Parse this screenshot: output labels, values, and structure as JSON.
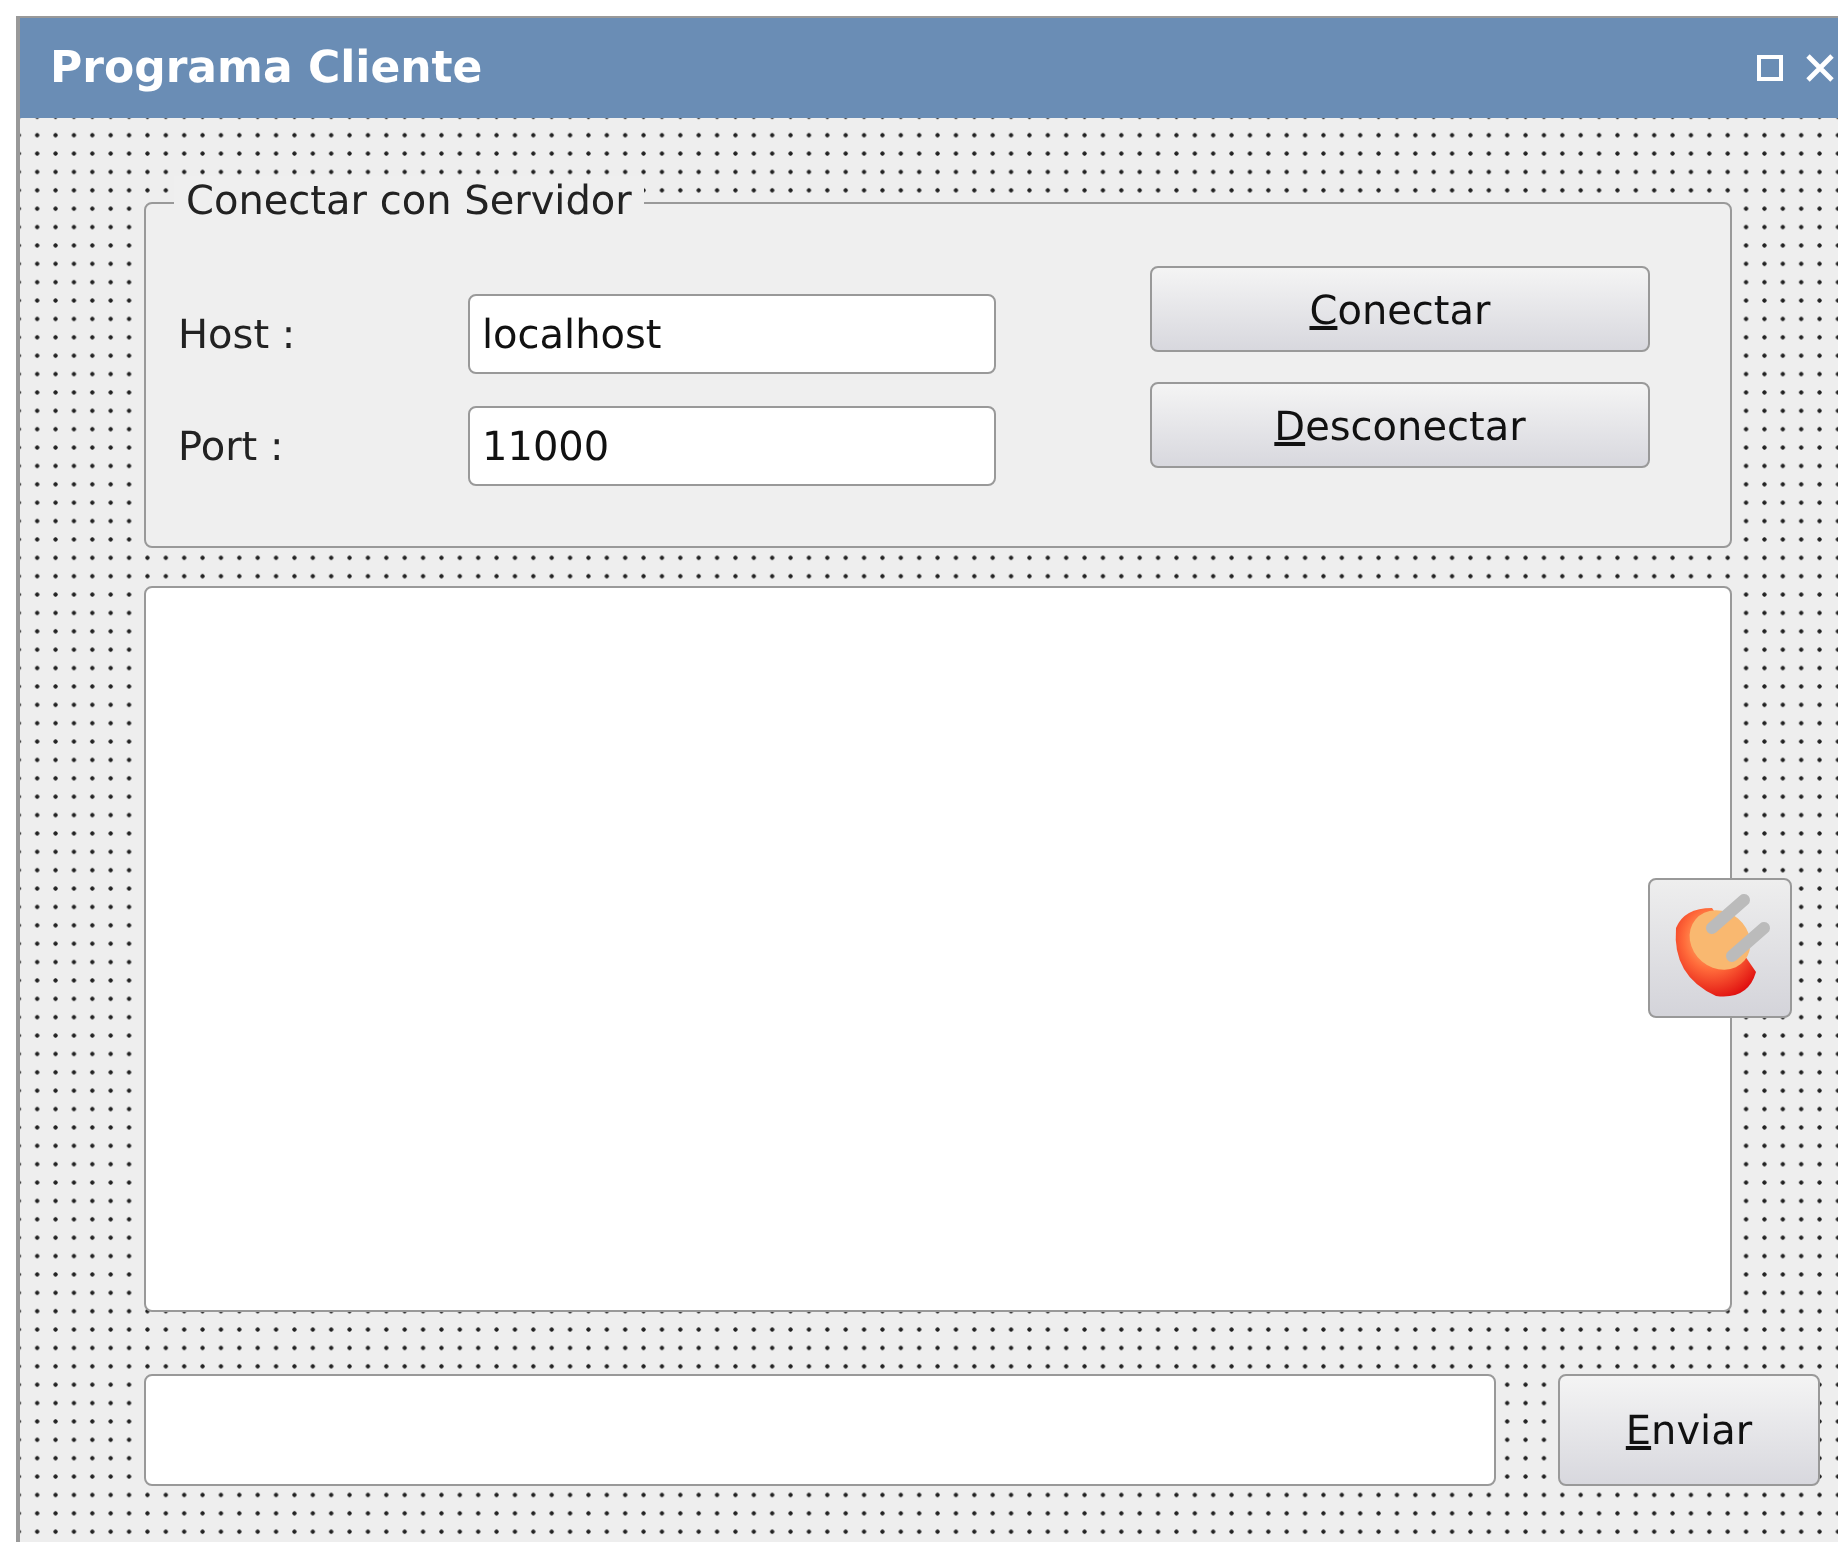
{
  "window": {
    "title": "Programa Cliente"
  },
  "group": {
    "title": "Conectar con Servidor",
    "fields": [
      {
        "label": "Host :",
        "value": "localhost"
      },
      {
        "label": "Port :",
        "value": "11000"
      }
    ],
    "buttons": [
      "Conectar",
      "Desconectar"
    ]
  },
  "send_button": "Enviar"
}
